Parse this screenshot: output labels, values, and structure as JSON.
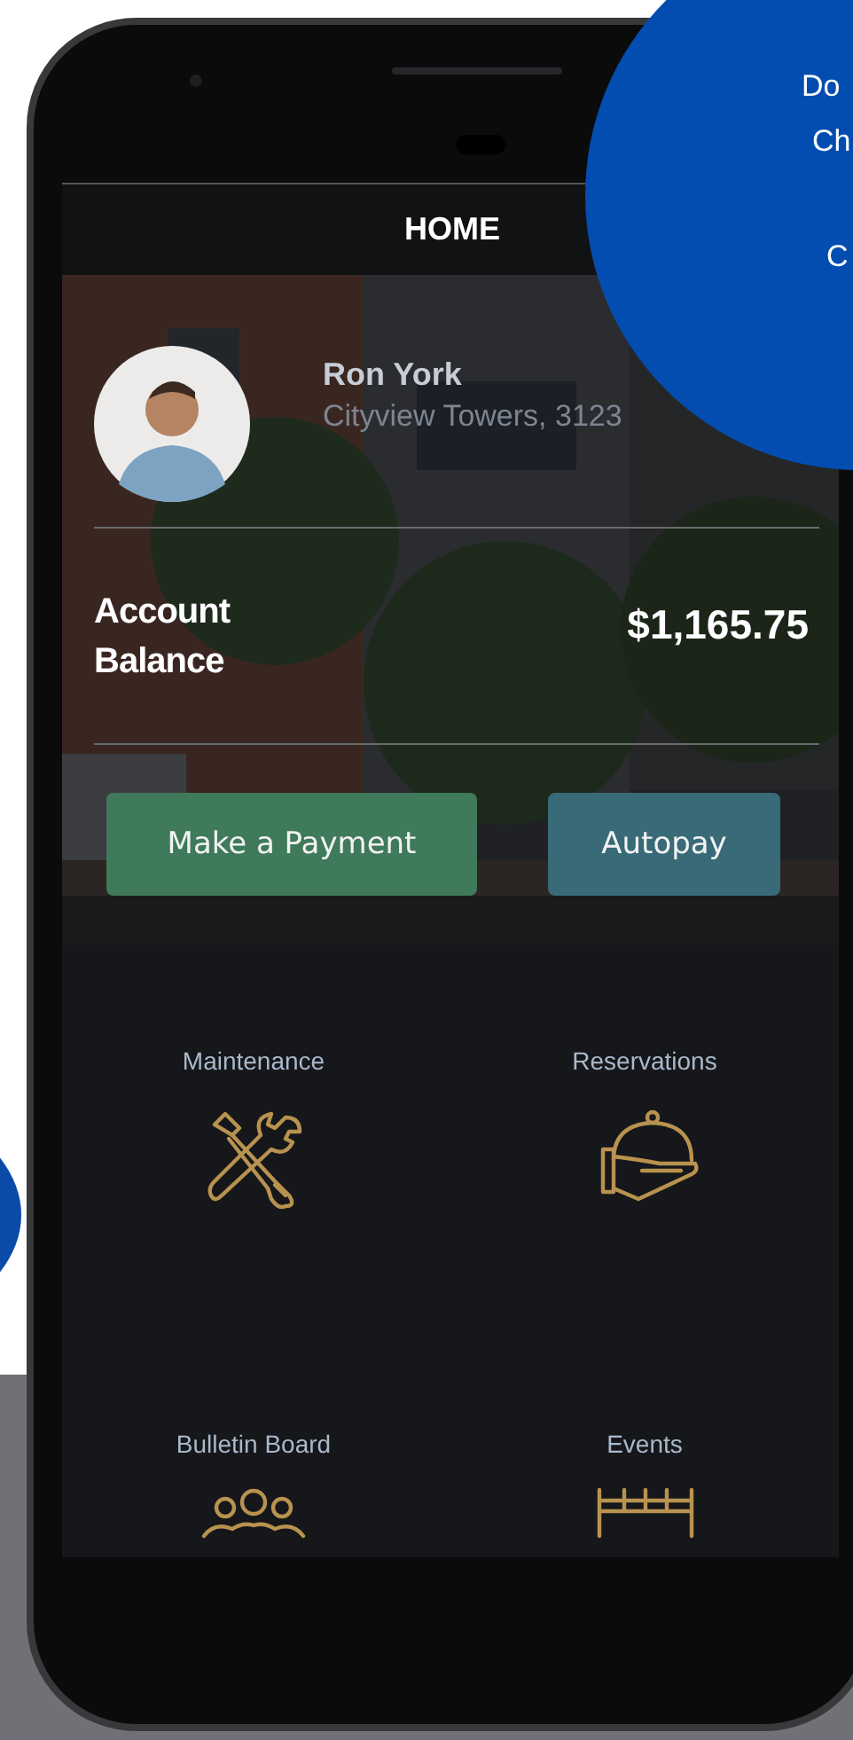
{
  "header": {
    "title": "HOME"
  },
  "profile": {
    "name": "Ron York",
    "address": "Cityview Towers, 3123"
  },
  "balance": {
    "label": "Account Balance",
    "amount": "$1,165.75"
  },
  "actions": [
    {
      "label": "Make a Payment",
      "kind": "primary"
    },
    {
      "label": "Autopay",
      "kind": "secondary"
    }
  ],
  "tiles": [
    {
      "label": "Maintenance",
      "kind": "tools"
    },
    {
      "label": "Reservations",
      "kind": "service"
    },
    {
      "label": "Bulletin Board",
      "kind": "people"
    },
    {
      "label": "Events",
      "kind": "calendar"
    }
  ],
  "promo": {
    "lines": [
      "Do",
      "Ch",
      "C"
    ]
  }
}
